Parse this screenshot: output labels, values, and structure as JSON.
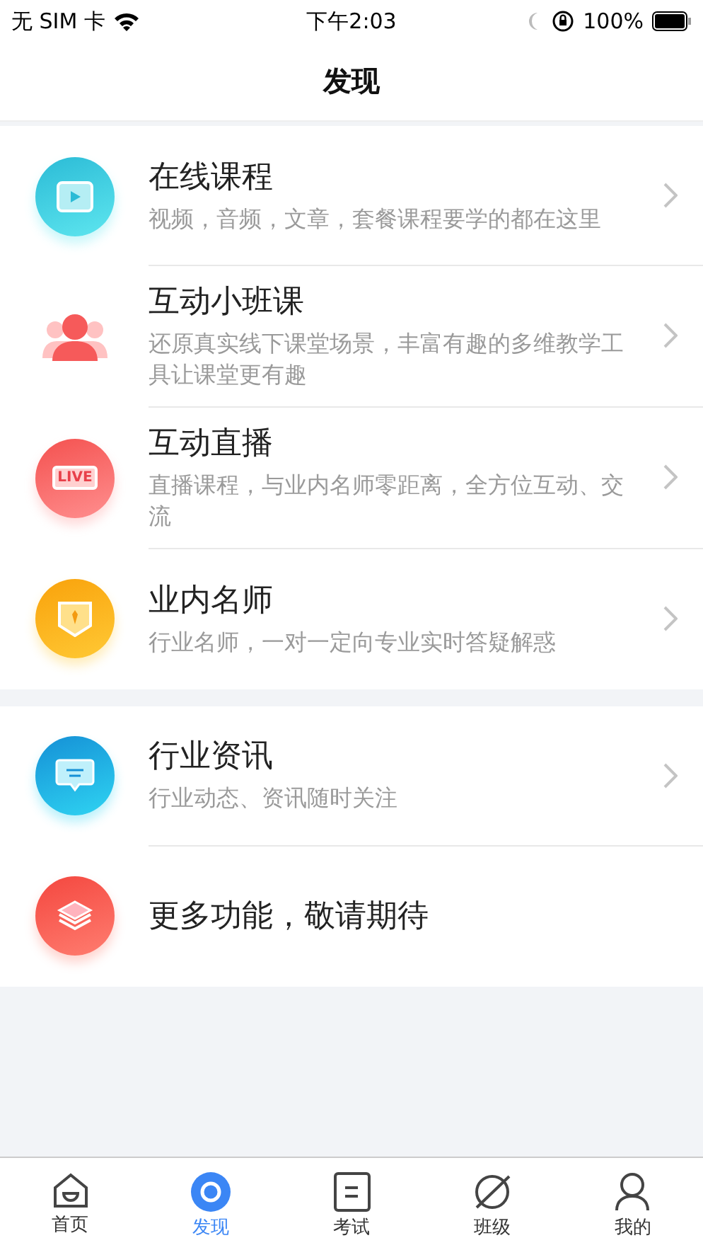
{
  "status_bar": {
    "carrier": "无 SIM 卡",
    "time": "下午2:03",
    "battery": "100%"
  },
  "nav": {
    "title": "发现"
  },
  "groups": [
    {
      "items": [
        {
          "kind": "video",
          "title": "在线课程",
          "subtitle": "视频，音频，文章，套餐课程要学的都在这里",
          "chevron": true
        },
        {
          "kind": "people",
          "title": "互动小班课",
          "subtitle": "还原真实线下课堂场景，丰富有趣的多维教学工具让课堂更有趣",
          "chevron": true
        },
        {
          "kind": "live",
          "badge": "LIVE",
          "title": "互动直播",
          "subtitle": "直播课程，与业内名师零距离，全方位互动、交流",
          "chevron": true
        },
        {
          "kind": "teacher",
          "title": "业内名师",
          "subtitle": "行业名师，一对一定向专业实时答疑解惑",
          "chevron": true
        }
      ]
    },
    {
      "items": [
        {
          "kind": "news",
          "title": "行业资讯",
          "subtitle": "行业动态、资讯随时关注",
          "chevron": true
        },
        {
          "kind": "more",
          "title": "更多功能，敬请期待",
          "chevron": false
        }
      ]
    }
  ],
  "tab_bar": [
    {
      "kind": "home",
      "label": "首页",
      "selected": false
    },
    {
      "kind": "discover",
      "label": "发现",
      "selected": true
    },
    {
      "kind": "exam",
      "label": "考试",
      "selected": false
    },
    {
      "kind": "class",
      "label": "班级",
      "selected": false
    },
    {
      "kind": "me",
      "label": "我的",
      "selected": false
    }
  ]
}
